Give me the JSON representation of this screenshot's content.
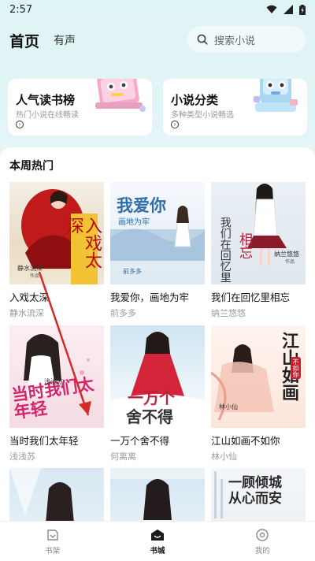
{
  "status": {
    "time": "2:57"
  },
  "header": {
    "tab_home": "首页",
    "tab_audio": "有声",
    "search_placeholder": "搜索小说"
  },
  "cards": [
    {
      "title": "人气读书榜",
      "subtitle": "热门小说在线畅读"
    },
    {
      "title": "小说分类",
      "subtitle": "多种类型小说畅选"
    }
  ],
  "section": {
    "title": "本周热门"
  },
  "books": [
    {
      "title": "入戏太深",
      "author": "静水流深"
    },
    {
      "title": "我爱你，画地为牢",
      "author": "前多多"
    },
    {
      "title": "我们在回忆里相忘",
      "author": "纳兰悠悠"
    },
    {
      "title": "当时我们太年轻",
      "author": "浅浅苏"
    },
    {
      "title": "一万个舍不得",
      "author": "何离离"
    },
    {
      "title": "江山如画不如你",
      "author": "林小仙"
    }
  ],
  "cover_text": {
    "b1": "入戏太深",
    "b1_author": "静水流深",
    "b1_sub": "作品",
    "b2": "我爱你",
    "b2_sub": "画地为牢",
    "b2_author": "前多多",
    "b3_a": "我们在回忆里",
    "b3_b": "相忘",
    "b3_author": "纳兰悠悠",
    "b3_sub": "作品",
    "b4": "当时我们太年轻",
    "b4_author": "浅浅苏",
    "b5_a": "一万个",
    "b5_b": "舍不得",
    "b6_a": "江山如画",
    "b6_b": "不如你",
    "b6_author": "林小仙",
    "b9_a": "一顾倾城",
    "b9_b": "从心而安"
  },
  "bottom_nav": [
    {
      "label": "书架",
      "icon": "bookshelf-icon"
    },
    {
      "label": "书城",
      "icon": "bookstore-icon"
    },
    {
      "label": "我的",
      "icon": "profile-icon"
    }
  ],
  "colors": {
    "accent": "#111111",
    "bg": "#dff4f5"
  }
}
